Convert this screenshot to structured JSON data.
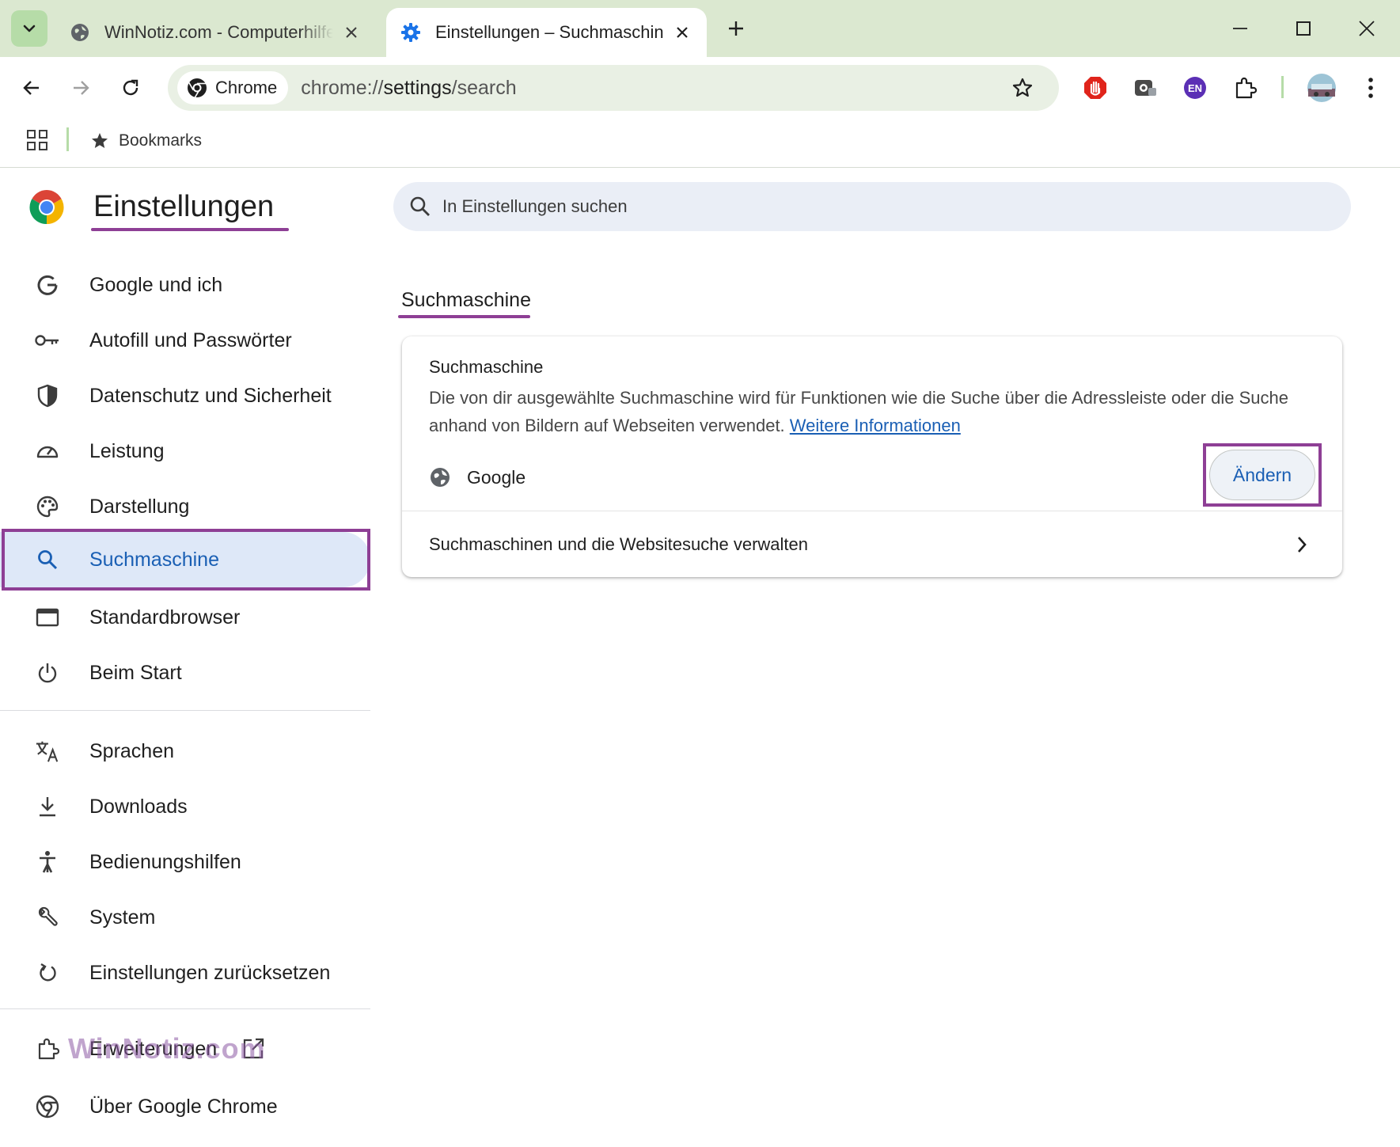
{
  "tabs": [
    {
      "title": "WinNotiz.com - Computerhilfe und Tipps",
      "active": false,
      "icon": "globe-icon"
    },
    {
      "title": "Einstellungen – Suchmaschine",
      "active": true,
      "icon": "gear-icon"
    }
  ],
  "toolbar": {
    "chip_label": "Chrome",
    "url_prefix": "chrome://",
    "url_host": "settings",
    "url_path": "/search",
    "extensions": [
      "stop-hand-icon",
      "screen-recorder-icon",
      "language-en-icon",
      "puzzle-icon"
    ],
    "language_badge": "EN"
  },
  "bookmarks": {
    "label": "Bookmarks"
  },
  "sidebar": {
    "title": "Einstellungen",
    "items": [
      {
        "label": "Google und ich",
        "icon": "google-g-icon"
      },
      {
        "label": "Autofill und Passwörter",
        "icon": "key-icon"
      },
      {
        "label": "Datenschutz und Sicherheit",
        "icon": "shield-icon"
      },
      {
        "label": "Leistung",
        "icon": "speedometer-icon"
      },
      {
        "label": "Darstellung",
        "icon": "palette-icon"
      },
      {
        "label": "Suchmaschine",
        "icon": "search-icon",
        "active": true
      },
      {
        "label": "Standardbrowser",
        "icon": "browser-window-icon"
      },
      {
        "label": "Beim Start",
        "icon": "power-icon"
      },
      {
        "label": "Sprachen",
        "icon": "translate-icon"
      },
      {
        "label": "Downloads",
        "icon": "download-icon"
      },
      {
        "label": "Bedienungshilfen",
        "icon": "accessibility-icon"
      },
      {
        "label": "System",
        "icon": "wrench-icon"
      },
      {
        "label": "Einstellungen zurücksetzen",
        "icon": "reset-icon"
      },
      {
        "label": "Erweiterungen",
        "icon": "puzzle-icon"
      },
      {
        "label": "Über Google Chrome",
        "icon": "chrome-icon"
      }
    ],
    "watermark": "WinNotiz.com"
  },
  "main": {
    "search_placeholder": "In Einstellungen suchen",
    "section_title": "Suchmaschine",
    "card": {
      "title": "Suchmaschine",
      "description": "Die von dir ausgewählte Suchmaschine wird für Funktionen wie die Suche über die Adressleiste oder die Suche anhand von Bildern auf Webseiten verwendet.",
      "link_label": "Weitere Informationen",
      "engine_name": "Google",
      "change_label": "Ändern",
      "manage_label": "Suchmaschinen und die Websitesuche verwalten"
    }
  },
  "colors": {
    "frame": "#dbe8d0",
    "accent_blue": "#1a5fb4",
    "highlight_box": "#8e3f95",
    "active_nav_bg": "#dee8f8"
  }
}
